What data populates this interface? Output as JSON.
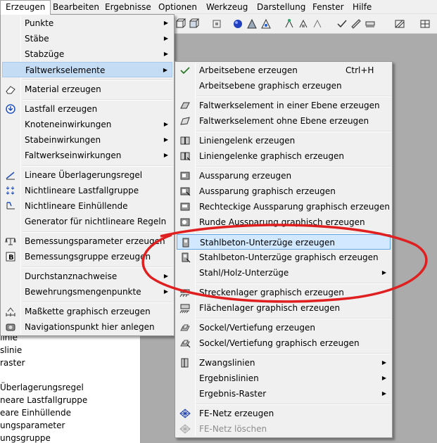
{
  "menubar": [
    "Erzeugen",
    "Bearbeiten",
    "Ergebnisse",
    "Optionen",
    "Werkzeug",
    "Darstellung",
    "Fenster",
    "Hilfe"
  ],
  "left_panel": [
    "linie",
    "slinie",
    "raster",
    "Überlagerungsregel",
    "neare Lastfallgruppe",
    "eare Einhüllende",
    "ungsparameter",
    "ungsgruppe"
  ],
  "menu1": [
    {
      "label": "Punkte",
      "sub": true
    },
    {
      "label": "Stäbe",
      "sub": true
    },
    {
      "label": "Stabzüge",
      "sub": true
    },
    {
      "label": "Faltwerkselemente",
      "sub": true
    },
    {
      "label": "Material erzeugen",
      "icon": "eraser-icon"
    },
    {
      "label": "Lastfall erzeugen",
      "icon": "load-case-icon"
    },
    {
      "label": "Knoteneinwirkungen",
      "sub": true
    },
    {
      "label": "Stabeinwirkungen",
      "sub": true
    },
    {
      "label": "Faltwerkseinwirkungen",
      "sub": true
    },
    {
      "label": "Lineare Überlagerungsregel",
      "icon": "linear-superposition-icon"
    },
    {
      "label": "Nichtlineare Lastfallgruppe",
      "icon": "nonlinear-group-icon"
    },
    {
      "label": "Nichtlineare Einhüllende",
      "icon": "nonlinear-envelope-icon"
    },
    {
      "label": "Generator für nichtlineare Regeln"
    },
    {
      "label": "Bemessungsparameter erzeugen",
      "icon": "design-parameter-icon"
    },
    {
      "label": "Bemessungsgruppe erzeugen",
      "icon": "design-group-icon"
    },
    {
      "label": "Durchstanznachweise",
      "sub": true
    },
    {
      "label": "Bewehrungsmengenpunkte",
      "sub": true
    },
    {
      "label": "Maßkette graphisch erzeugen",
      "icon": "dimension-chain-icon"
    },
    {
      "label": "Navigationspunkt hier anlegen",
      "icon": "camera-icon"
    }
  ],
  "menu2": [
    {
      "label": "Arbeitsebene erzeugen",
      "shortcut": "Ctrl+H",
      "icon": "check-plane-icon"
    },
    {
      "label": "Arbeitsebene graphisch erzeugen"
    },
    {
      "label": "Faltwerkselement in einer Ebene erzeugen",
      "icon": "plate-in-plane-icon"
    },
    {
      "label": "Faltwerkselement ohne Ebene erzeugen",
      "icon": "plate-no-plane-icon"
    },
    {
      "label": "Liniengelenk erzeugen",
      "icon": "line-hinge-icon"
    },
    {
      "label": "Liniengelenke graphisch erzeugen",
      "icon": "line-hinge-graphic-icon"
    },
    {
      "label": "Aussparung erzeugen",
      "icon": "opening-icon"
    },
    {
      "label": "Aussparung graphisch erzeugen",
      "icon": "opening-graphic-icon"
    },
    {
      "label": "Rechteckige Aussparung graphisch erzeugen",
      "icon": "rect-opening-icon"
    },
    {
      "label": "Runde Aussparung graphisch erzeugen",
      "icon": "round-opening-icon"
    },
    {
      "label": "Stahlbeton-Unterzüge erzeugen",
      "icon": "concrete-beam-icon"
    },
    {
      "label": "Stahlbeton-Unterzüge graphisch erzeugen",
      "icon": "concrete-beam-graphic-icon"
    },
    {
      "label": "Stahl/Holz-Unterzüge",
      "sub": true
    },
    {
      "label": "Streckenlager graphisch erzeugen",
      "icon": "line-support-icon"
    },
    {
      "label": "Flächenlager graphisch erzeugen",
      "icon": "area-support-icon"
    },
    {
      "label": "Sockel/Vertiefung erzeugen",
      "icon": "socket-icon"
    },
    {
      "label": "Sockel/Vertiefung graphisch erzeugen",
      "icon": "socket-graphic-icon"
    },
    {
      "label": "Zwangslinien",
      "sub": true
    },
    {
      "label": "Ergebnislinien",
      "sub": true
    },
    {
      "label": "Ergebnis-Raster",
      "sub": true
    },
    {
      "label": "FE-Netz erzeugen",
      "icon": "fe-mesh-icon"
    },
    {
      "label": "FE-Netz löschen",
      "icon": "fe-mesh-delete-icon",
      "disabled": true
    }
  ],
  "arrow_glyph": "▶",
  "colors": {
    "highlight": "#d1e8ff",
    "highlight_border": "#66a7e8",
    "ring": "#e02020"
  }
}
